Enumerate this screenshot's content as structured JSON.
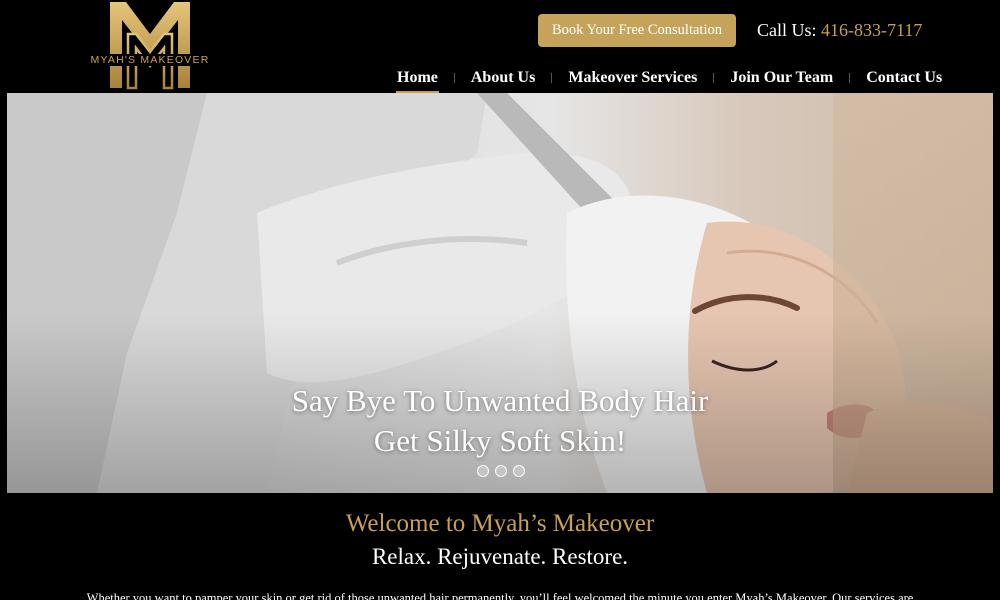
{
  "brand": {
    "name": "MYAH'S MAKEOVER",
    "gold": "#c9a052",
    "button_bg": "#c5a35b"
  },
  "header": {
    "cta_label": "Book Your Free Consultation",
    "phone_label": "Call Us:",
    "phone_number": "416-833-7117"
  },
  "nav": {
    "items": [
      {
        "label": "Home",
        "active": true
      },
      {
        "label": "About Us"
      },
      {
        "label": "Makeover Services"
      },
      {
        "label": "Join Our Team"
      },
      {
        "label": "Contact Us"
      }
    ]
  },
  "hero": {
    "line1": "Say Bye To Unwanted Body Hair",
    "line2": "Get Silky Soft Skin!",
    "slide_count": 3
  },
  "welcome": {
    "title": "Welcome to Myah’s Makeover",
    "tagline": "Relax. Rejuvenate. Restore.",
    "body": "Whether you want to pamper your skin or get rid of those unwanted hair permanently, you’ll feel welcomed the minute you enter Myah’s Makeover. Our services are"
  }
}
